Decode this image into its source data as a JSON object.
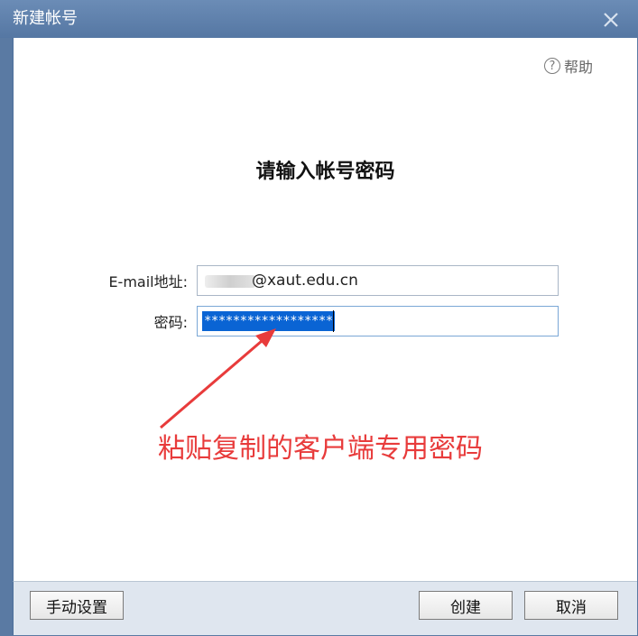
{
  "window": {
    "title": "新建帐号"
  },
  "help": {
    "label": "帮助",
    "icon": "question-circle-icon",
    "icon_glyph": "?"
  },
  "form": {
    "heading": "请输入帐号密码",
    "email_label": "E-mail地址:",
    "email_value": "@xaut.edu.cn",
    "password_label": "密码:",
    "password_value": "******************"
  },
  "annotation": {
    "text": "粘贴复制的客户端专用密码",
    "color": "#e83b3b"
  },
  "footer": {
    "manual_label": "手动设置",
    "create_label": "创建",
    "cancel_label": "取消"
  },
  "colors": {
    "titlebar": "#5a7aa3",
    "selection": "#0a64d4"
  }
}
